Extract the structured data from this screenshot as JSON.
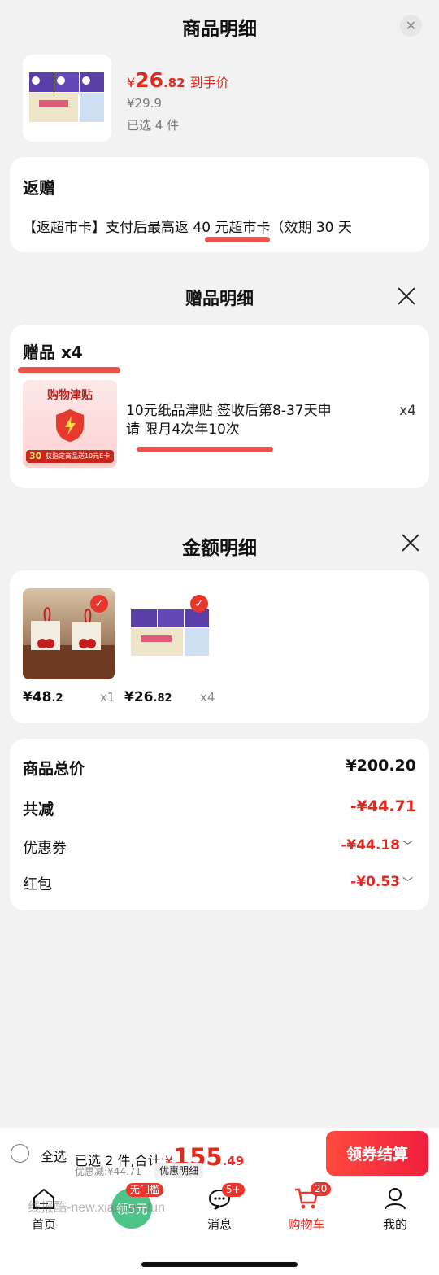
{
  "product_detail": {
    "title": "商品明细",
    "price_prefix": "¥",
    "price_int": "26",
    "price_dec": ".82",
    "price_tag": "到手价",
    "original_price": "¥29.9",
    "selected_count": "已选 4 件",
    "rebate": {
      "title": "返赠",
      "text": "【返超市卡】支付后最高返 40 元超市卡（效期 30 天"
    }
  },
  "gift_detail": {
    "title": "赠品明细",
    "gift_header": "赠品 x4",
    "gift_image_title": "购物津贴",
    "gift_image_sub": "获指定商品送10元E卡",
    "gift_image_badge": "30",
    "gift_desc_line1": "10元纸品津贴 签收后第8-37天申",
    "gift_desc_line2": "请 限月4次年10次",
    "gift_qty": "x4"
  },
  "amount_detail": {
    "title": "金额明细",
    "items": [
      {
        "price_int": "¥48",
        "price_dec": ".2",
        "qty": "x1",
        "image": "cherry-decoration"
      },
      {
        "price_int": "¥26",
        "price_dec": ".82",
        "qty": "x4",
        "image": "tissue-pack"
      }
    ],
    "rows": [
      {
        "label": "商品总价",
        "value": "¥200.20"
      },
      {
        "label": "共减",
        "value": "-¥44.71"
      },
      {
        "label": "优惠券",
        "value": "-¥44.18"
      },
      {
        "label": "红包",
        "value": "-¥0.53"
      }
    ]
  },
  "checkout_bar": {
    "select_all": "全选",
    "summary": "已选 2 件,合计:",
    "total_prefix": "¥",
    "total_int": "155",
    "total_dec": ".49",
    "discount": "优惠减:¥44.71",
    "detail_link": "优惠明细",
    "checkout_button": "领券结算"
  },
  "tabbar": {
    "home": "首页",
    "coupon_badge": "无门槛",
    "coupon": "领5元",
    "messages": "消息",
    "messages_badge": "5+",
    "cart": "购物车",
    "cart_badge": "20",
    "mine": "我的"
  },
  "watermark": "线报酷-new.xianbao.fun",
  "colors": {
    "accent": "#e12a1f",
    "coupon_green": "#4cc48a"
  }
}
